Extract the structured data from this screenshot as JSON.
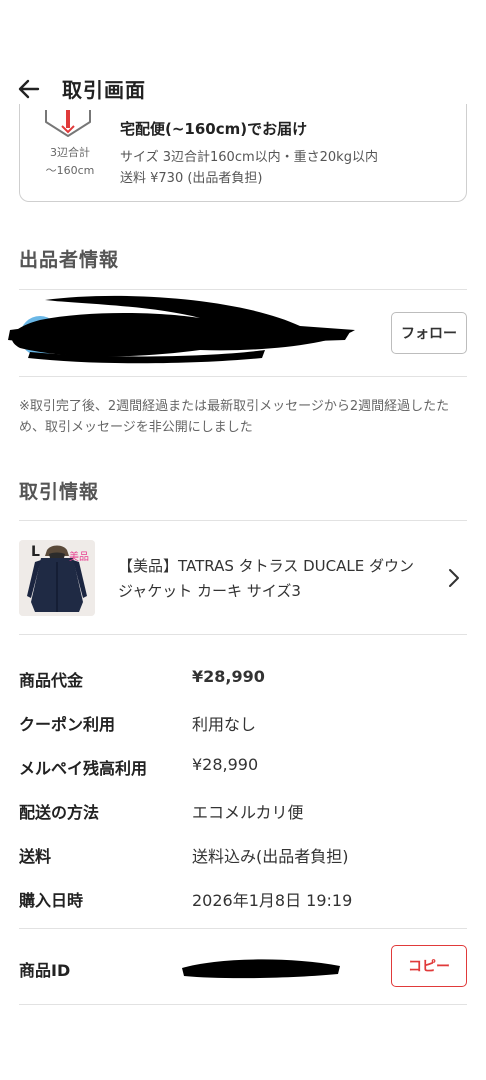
{
  "header": {
    "title": "取引画面",
    "back_icon": "arrow-left-icon"
  },
  "shipping": {
    "box_icon": "box-icon",
    "size_note_1": "3辺合計",
    "size_note_2": "〜160cm",
    "title": "宅配便(~160cm)でお届け",
    "spec": "サイズ  3辺合計160cm以内・重さ20kg以内",
    "fee": "送料  ¥730 (出品者負担)"
  },
  "seller": {
    "section_title": "出品者情報",
    "follow_label": "フォロー",
    "notice": "※取引完了後、2週間経過または最新取引メッセージから2週間経過したため、取引メッセージを非公開にしました"
  },
  "transaction": {
    "section_title": "取引情報",
    "product": {
      "thumb_size": "L",
      "thumb_badge": "美品",
      "name": "【美品】TATRAS タトラス DUCALE ダウンジャケット カーキ サイズ3",
      "chevron_icon": "chevron-right-icon"
    },
    "rows": [
      {
        "label": "商品代金",
        "value": "¥28,990"
      },
      {
        "label": "クーポン利用",
        "value": "利用なし"
      },
      {
        "label": "メルペイ残高利用",
        "value": "¥28,990"
      },
      {
        "label": "配送の方法",
        "value": "エコメルカリ便"
      },
      {
        "label": "送料",
        "value": "送料込み(出品者負担)"
      },
      {
        "label": "購入日時",
        "value": "2026年1月8日 19:19"
      }
    ],
    "product_id_label": "商品ID",
    "copy_label": "コピー"
  },
  "colors": {
    "accent": "#e03a3a",
    "text": "#222222",
    "muted": "#666666",
    "divider": "#e2e2e2"
  }
}
